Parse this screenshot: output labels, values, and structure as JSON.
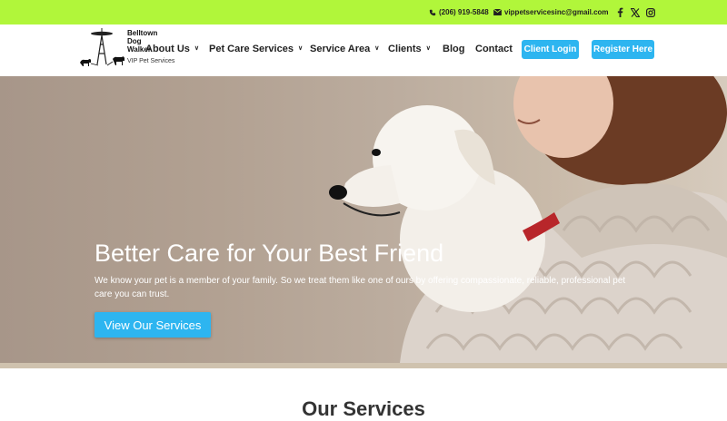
{
  "topbar": {
    "phone": "(206) 919-5848",
    "email": "vippetservicesinc@gmail.com",
    "social": [
      "facebook-icon",
      "x-icon",
      "instagram-icon"
    ]
  },
  "logo": {
    "name": "Belltown Dog Walker",
    "tagline": "VIP Pet Services"
  },
  "nav": {
    "items": [
      {
        "label": "About Us",
        "dropdown": true
      },
      {
        "label": "Pet Care Services",
        "dropdown": true
      },
      {
        "label": "Service Area",
        "dropdown": true
      },
      {
        "label": "Clients",
        "dropdown": true
      },
      {
        "label": "Blog",
        "dropdown": false
      },
      {
        "label": "Contact",
        "dropdown": false
      }
    ],
    "client_login": "Client Login",
    "register": "Register Here"
  },
  "hero": {
    "title": "Better Care for Your Best Friend",
    "subtitle": "We know your pet is a member of your family. So we treat them like one of ours by offering compassionate, reliable, professional pet care you can trust.",
    "cta": "View Our Services"
  },
  "services": {
    "title": "Our Services"
  },
  "colors": {
    "topbar": "#b1f63a",
    "accent": "#2db5f0"
  }
}
